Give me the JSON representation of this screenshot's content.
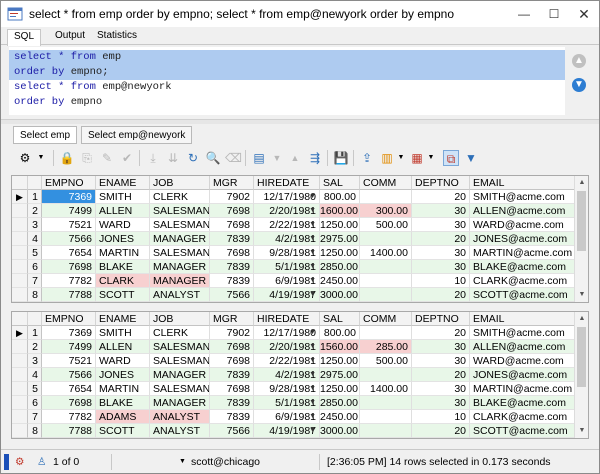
{
  "window": {
    "title": "select * from emp order by empno; select * from emp@newyork order by empno",
    "min_label": "—",
    "max_label": "☐",
    "close_label": "✕"
  },
  "editor_tabs": [
    "SQL",
    "Output",
    "Statistics"
  ],
  "editor": {
    "lines": [
      {
        "kw": "select * from",
        "rest": " emp"
      },
      {
        "kw": "order by",
        "rest": " empno;"
      },
      {
        "kw": "select * from",
        "rest": " emp@newyork"
      },
      {
        "kw": "order by",
        "rest": " empno"
      }
    ],
    "side_up": "▲",
    "side_down": "▼"
  },
  "result_tabs": [
    "Select emp",
    "Select emp@newyork"
  ],
  "columns": [
    "EMPNO",
    "ENAME",
    "JOB",
    "MGR",
    "HIREDATE",
    "SAL",
    "COMM",
    "DEPTNO",
    "EMAIL"
  ],
  "grid1": {
    "rows": [
      {
        "n": "1",
        "empno": "7369",
        "ename": "SMITH",
        "job": "CLERK",
        "mgr": "7902",
        "hiredate": "12/17/1980",
        "sal": "800.00",
        "comm": "",
        "deptno": "20",
        "email": "SMITH@acme.com"
      },
      {
        "n": "2",
        "empno": "7499",
        "ename": "ALLEN",
        "job": "SALESMAN",
        "mgr": "7698",
        "hiredate": "2/20/1981",
        "sal": "1600.00",
        "comm": "300.00",
        "deptno": "30",
        "email": "ALLEN@acme.com"
      },
      {
        "n": "3",
        "empno": "7521",
        "ename": "WARD",
        "job": "SALESMAN",
        "mgr": "7698",
        "hiredate": "2/22/1981",
        "sal": "1250.00",
        "comm": "500.00",
        "deptno": "30",
        "email": "WARD@acme.com"
      },
      {
        "n": "4",
        "empno": "7566",
        "ename": "JONES",
        "job": "MANAGER",
        "mgr": "7839",
        "hiredate": "4/2/1981",
        "sal": "2975.00",
        "comm": "",
        "deptno": "20",
        "email": "JONES@acme.com"
      },
      {
        "n": "5",
        "empno": "7654",
        "ename": "MARTIN",
        "job": "SALESMAN",
        "mgr": "7698",
        "hiredate": "9/28/1981",
        "sal": "1250.00",
        "comm": "1400.00",
        "deptno": "30",
        "email": "MARTIN@acme.com"
      },
      {
        "n": "6",
        "empno": "7698",
        "ename": "BLAKE",
        "job": "MANAGER",
        "mgr": "7839",
        "hiredate": "5/1/1981",
        "sal": "2850.00",
        "comm": "",
        "deptno": "30",
        "email": "BLAKE@acme.com"
      },
      {
        "n": "7",
        "empno": "7782",
        "ename": "CLARK",
        "job": "MANAGER",
        "mgr": "7839",
        "hiredate": "6/9/1981",
        "sal": "2450.00",
        "comm": "",
        "deptno": "10",
        "email": "CLARK@acme.com"
      },
      {
        "n": "8",
        "empno": "7788",
        "ename": "SCOTT",
        "job": "ANALYST",
        "mgr": "7566",
        "hiredate": "4/19/1987",
        "sal": "3000.00",
        "comm": "",
        "deptno": "20",
        "email": "SCOTT@acme.com"
      }
    ]
  },
  "grid2": {
    "rows": [
      {
        "n": "1",
        "empno": "7369",
        "ename": "SMITH",
        "job": "CLERK",
        "mgr": "7902",
        "hiredate": "12/17/1980",
        "sal": "800.00",
        "comm": "",
        "deptno": "20",
        "email": "SMITH@acme.com"
      },
      {
        "n": "2",
        "empno": "7499",
        "ename": "ALLEN",
        "job": "SALESMAN",
        "mgr": "7698",
        "hiredate": "2/20/1981",
        "sal": "1560.00",
        "comm": "285.00",
        "deptno": "30",
        "email": "ALLEN@acme.com"
      },
      {
        "n": "3",
        "empno": "7521",
        "ename": "WARD",
        "job": "SALESMAN",
        "mgr": "7698",
        "hiredate": "2/22/1981",
        "sal": "1250.00",
        "comm": "500.00",
        "deptno": "30",
        "email": "WARD@acme.com"
      },
      {
        "n": "4",
        "empno": "7566",
        "ename": "JONES",
        "job": "MANAGER",
        "mgr": "7839",
        "hiredate": "4/2/1981",
        "sal": "2975.00",
        "comm": "",
        "deptno": "20",
        "email": "JONES@acme.com"
      },
      {
        "n": "5",
        "empno": "7654",
        "ename": "MARTIN",
        "job": "SALESMAN",
        "mgr": "7698",
        "hiredate": "9/28/1981",
        "sal": "1250.00",
        "comm": "1400.00",
        "deptno": "30",
        "email": "MARTIN@acme.com"
      },
      {
        "n": "6",
        "empno": "7698",
        "ename": "BLAKE",
        "job": "MANAGER",
        "mgr": "7839",
        "hiredate": "5/1/1981",
        "sal": "2850.00",
        "comm": "",
        "deptno": "30",
        "email": "BLAKE@acme.com"
      },
      {
        "n": "7",
        "empno": "7782",
        "ename": "ADAMS",
        "job": "ANALYST",
        "mgr": "7839",
        "hiredate": "6/9/1981",
        "sal": "2450.00",
        "comm": "",
        "deptno": "10",
        "email": "CLARK@acme.com"
      },
      {
        "n": "8",
        "empno": "7788",
        "ename": "SCOTT",
        "job": "ANALYST",
        "mgr": "7566",
        "hiredate": "4/19/1987",
        "sal": "3000.00",
        "comm": "",
        "deptno": "20",
        "email": "SCOTT@acme.com"
      }
    ]
  },
  "status": {
    "record": "1 of 0",
    "connection": "scott@chicago",
    "message": "[2:36:05 PM]  14 rows selected in 0.173 seconds"
  },
  "colors": {
    "selection": "#aecbf0",
    "alt_row": "#e8f7e8",
    "diff_cell": "#f7d0d0",
    "selected_cell": "#3390e0",
    "keyword": "#1a1aa6"
  }
}
